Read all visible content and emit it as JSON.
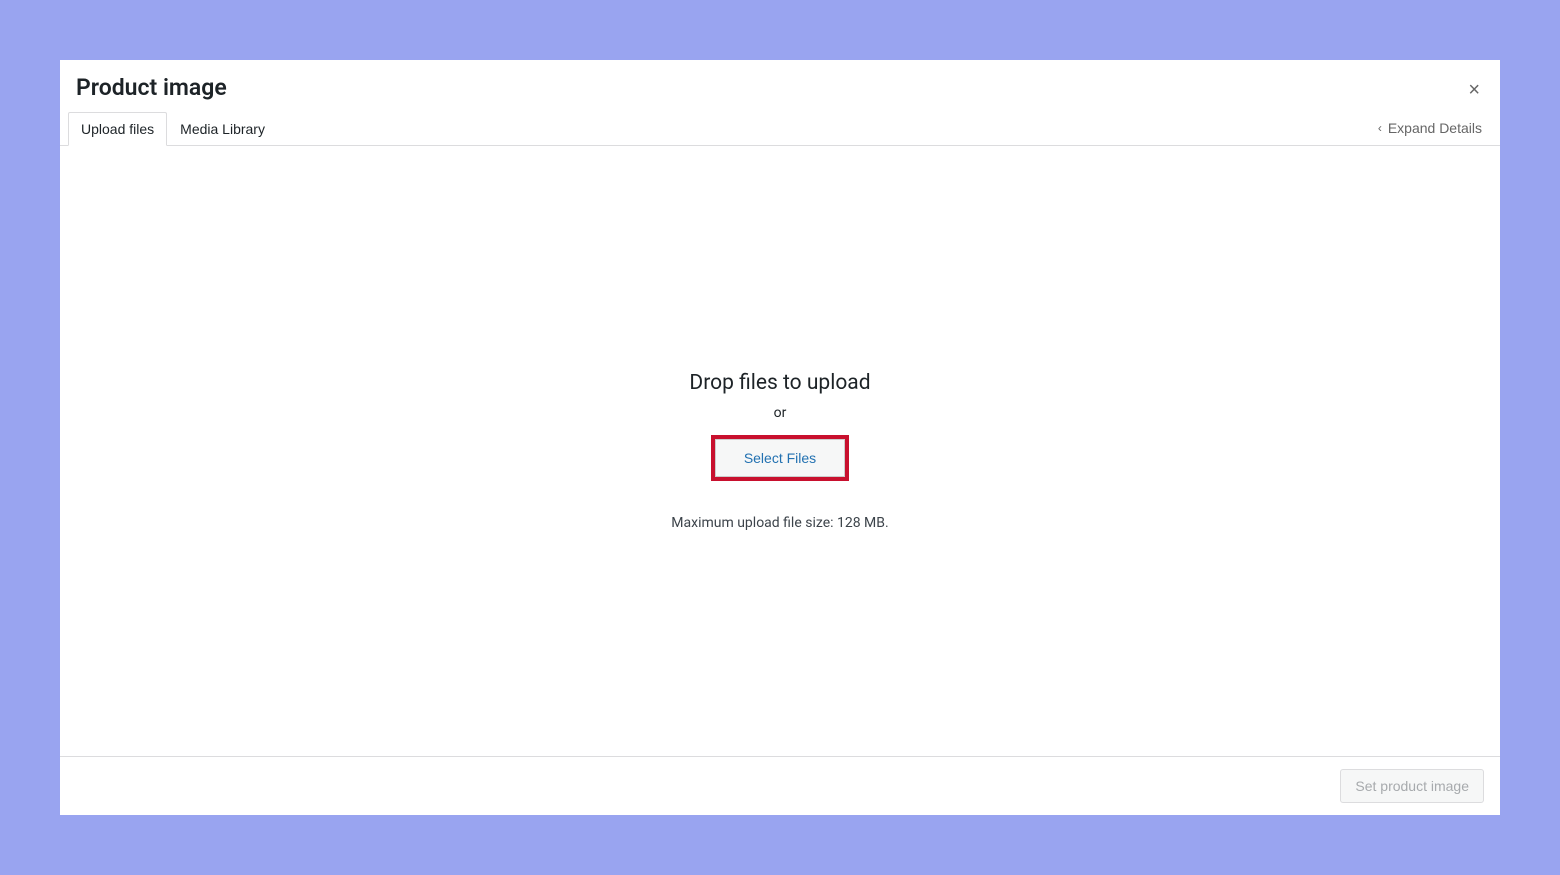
{
  "modal": {
    "title": "Product image",
    "close_icon": "×"
  },
  "tabs": {
    "upload_files": "Upload files",
    "media_library": "Media Library"
  },
  "expand_details": {
    "label": "Expand Details"
  },
  "upload": {
    "drop_heading": "Drop files to upload",
    "or_text": "or",
    "select_button": "Select Files",
    "max_size_text": "Maximum upload file size: 128 MB."
  },
  "footer": {
    "set_image_button": "Set product image"
  }
}
